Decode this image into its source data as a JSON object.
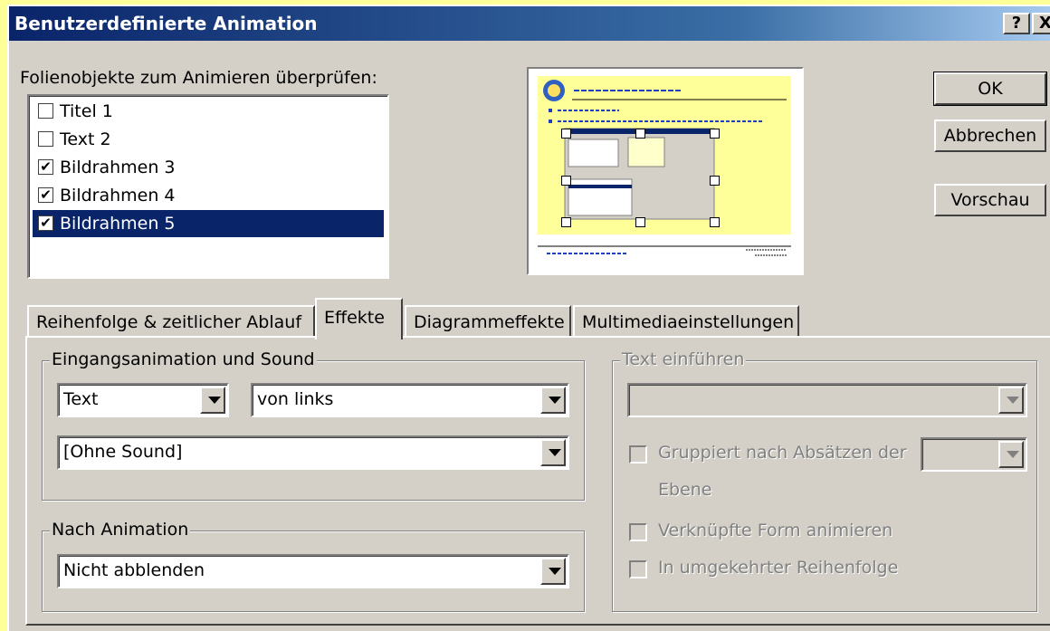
{
  "window": {
    "title": "Benutzerdefinierte Animation",
    "help_button": "?",
    "close_button": "X"
  },
  "objects_list": {
    "label": "Folienobjekte zum Animieren überprüfen:",
    "items": [
      {
        "label": "Titel 1",
        "checked": false,
        "check": "",
        "selected": false
      },
      {
        "label": "Text 2",
        "checked": false,
        "check": "",
        "selected": false
      },
      {
        "label": "Bildrahmen 3",
        "checked": true,
        "check": "✔",
        "selected": false
      },
      {
        "label": "Bildrahmen 4",
        "checked": true,
        "check": "✔",
        "selected": false
      },
      {
        "label": "Bildrahmen 5",
        "checked": true,
        "check": "✔",
        "selected": true
      }
    ]
  },
  "buttons": {
    "ok": "OK",
    "cancel": "Abbrechen",
    "preview": "Vorschau"
  },
  "tabs": [
    {
      "label": "Reihenfolge & zeitlicher Ablauf",
      "active": false
    },
    {
      "label": "Effekte",
      "active": true
    },
    {
      "label": "Diagrammeffekte",
      "active": false
    },
    {
      "label": "Multimediaeinstellungen",
      "active": false
    }
  ],
  "entry_group": {
    "title": "Eingangsanimation und Sound",
    "effect_value": "Text",
    "direction_value": "von links",
    "sound_value": "[Ohne Sound]"
  },
  "after_group": {
    "title": "Nach Animation",
    "value": "Nicht abblenden"
  },
  "text_group": {
    "title": "Text einführen",
    "value": "",
    "group_by_label": "Gruppiert nach Absätzen der",
    "level_label": "Ebene",
    "level_value": "",
    "animate_shape_label": "Verknüpfte Form animieren",
    "reverse_label": "In umgekehrter Reihenfolge"
  },
  "colors": {
    "dialog_face": "#d4d0c8",
    "title_bar": "#0a246a",
    "selection": "#0a246a",
    "background": "#ffff99"
  }
}
